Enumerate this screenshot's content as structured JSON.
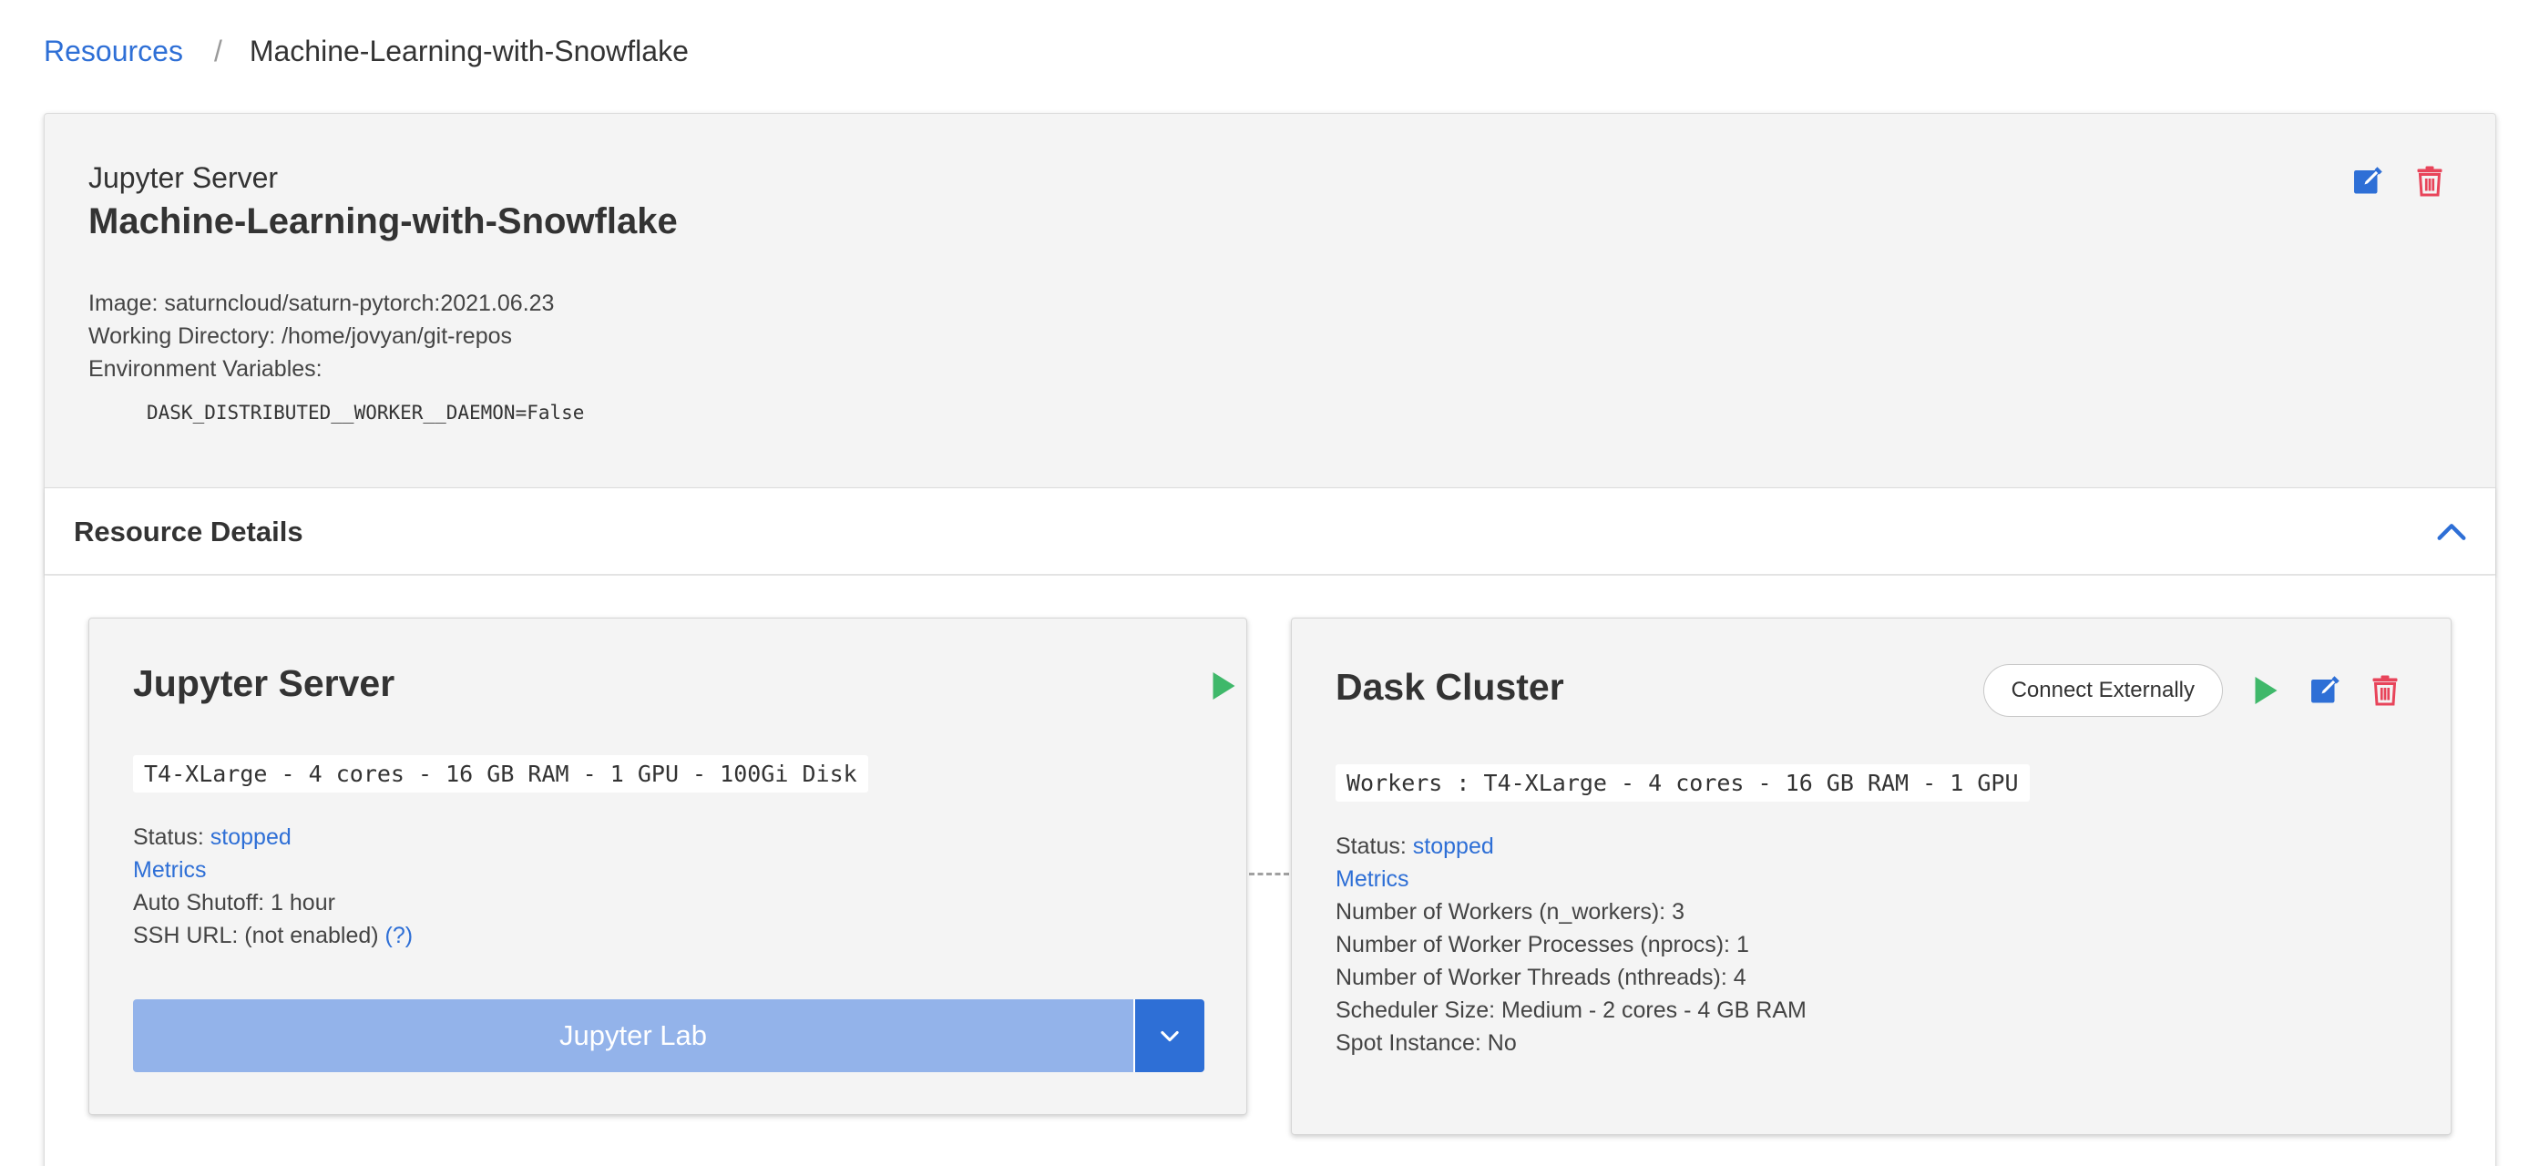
{
  "breadcrumb": {
    "root": "Resources",
    "separator": "/",
    "current": "Machine-Learning-with-Snowflake"
  },
  "resource": {
    "type": "Jupyter Server",
    "name": "Machine-Learning-with-Snowflake",
    "image_label": "Image:",
    "image_value": "saturncloud/saturn-pytorch:2021.06.23",
    "workdir_label": "Working Directory:",
    "workdir_value": "/home/jovyan/git-repos",
    "env_label": "Environment Variables:",
    "env_vars": [
      "DASK_DISTRIBUTED__WORKER__DAEMON=False"
    ]
  },
  "details": {
    "title": "Resource Details"
  },
  "jupyter_card": {
    "title": "Jupyter Server",
    "spec": "T4-XLarge - 4 cores - 16 GB RAM - 1 GPU - 100Gi Disk",
    "status_label": "Status:",
    "status_value": "stopped",
    "metrics_link": "Metrics",
    "auto_shutoff": "Auto Shutoff: 1 hour",
    "ssh_url": "SSH URL: (not enabled)",
    "ssh_help": "(?)",
    "lab_button": "Jupyter Lab"
  },
  "dask_card": {
    "title": "Dask Cluster",
    "connect_button": "Connect Externally",
    "spec": "Workers : T4-XLarge - 4 cores - 16 GB RAM - 1 GPU",
    "status_label": "Status:",
    "status_value": "stopped",
    "metrics_link": "Metrics",
    "n_workers": "Number of Workers (n_workers): 3",
    "nprocs": "Number of Worker Processes (nprocs): 1",
    "nthreads": "Number of Worker Threads (nthreads): 4",
    "scheduler_size": "Scheduler Size: Medium - 2 cores - 4 GB RAM",
    "spot_instance": "Spot Instance: No"
  },
  "colors": {
    "link": "#2e6fd6",
    "play": "#3fb86a",
    "delete": "#e8445a",
    "edit": "#2e6fd6",
    "lab_button_disabled": "#93b3ea"
  },
  "icons": {
    "edit": "edit-icon",
    "delete": "trash-icon",
    "play": "play-icon",
    "collapse": "chevron-up-icon",
    "dropdown": "chevron-down-icon"
  }
}
